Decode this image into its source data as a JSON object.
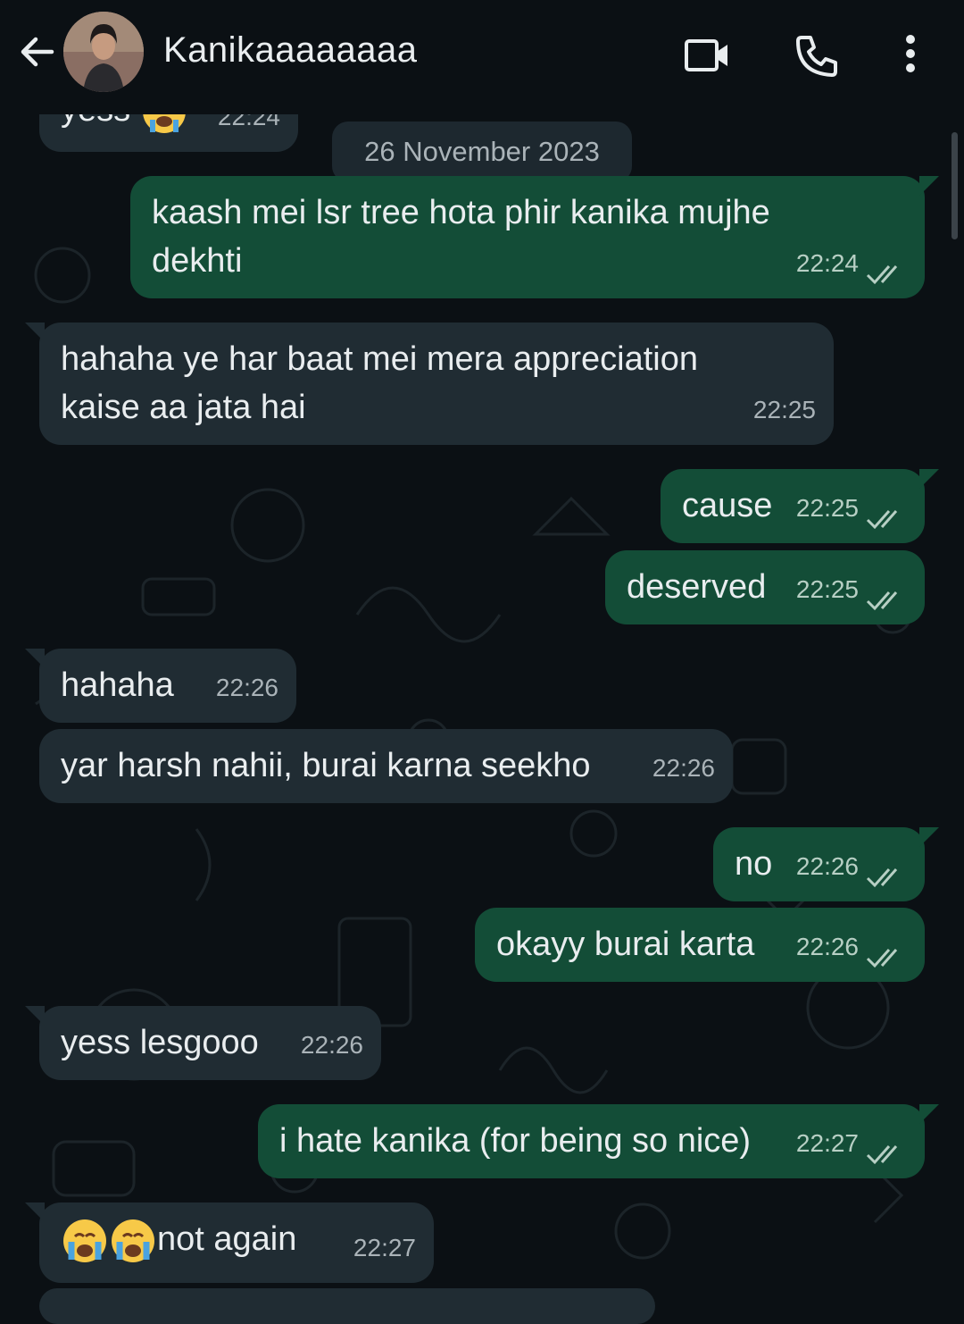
{
  "header": {
    "contact_name": "Kanikaaaaaaaa",
    "back_icon": "arrow-left-icon",
    "video_icon": "video-call-icon",
    "call_icon": "phone-icon",
    "menu_icon": "more-vertical-icon"
  },
  "date_chip": "26 November 2023",
  "colors": {
    "background": "#0b1014",
    "incoming_bubble": "#202c33",
    "outgoing_bubble": "#134d37",
    "timestamp": "#aab3b8"
  },
  "messages": [
    {
      "dir": "in",
      "text": "yess",
      "emoji": "crying-face",
      "time": "22:24"
    },
    {
      "dir": "out",
      "text": "kaash mei lsr tree hota phir kanika mujhe dekhti",
      "time": "22:24"
    },
    {
      "dir": "in",
      "text": "hahaha ye har baat mei mera appreciation kaise aa jata hai",
      "time": "22:25"
    },
    {
      "dir": "out",
      "text": "cause",
      "time": "22:25"
    },
    {
      "dir": "out",
      "text": "deserved",
      "time": "22:25"
    },
    {
      "dir": "in",
      "text": "hahaha",
      "time": "22:26"
    },
    {
      "dir": "in",
      "text": "yar harsh nahii, burai karna seekho",
      "time": "22:26"
    },
    {
      "dir": "out",
      "text": "no",
      "time": "22:26"
    },
    {
      "dir": "out",
      "text": "okayy burai karta",
      "time": "22:26"
    },
    {
      "dir": "in",
      "text": "yess lesgooo",
      "time": "22:26"
    },
    {
      "dir": "out",
      "text": "i hate kanika (for being so nice)",
      "time": "22:27"
    },
    {
      "dir": "in",
      "text": "not again",
      "emoji": "crying-face crying-face",
      "time": "22:27"
    }
  ]
}
